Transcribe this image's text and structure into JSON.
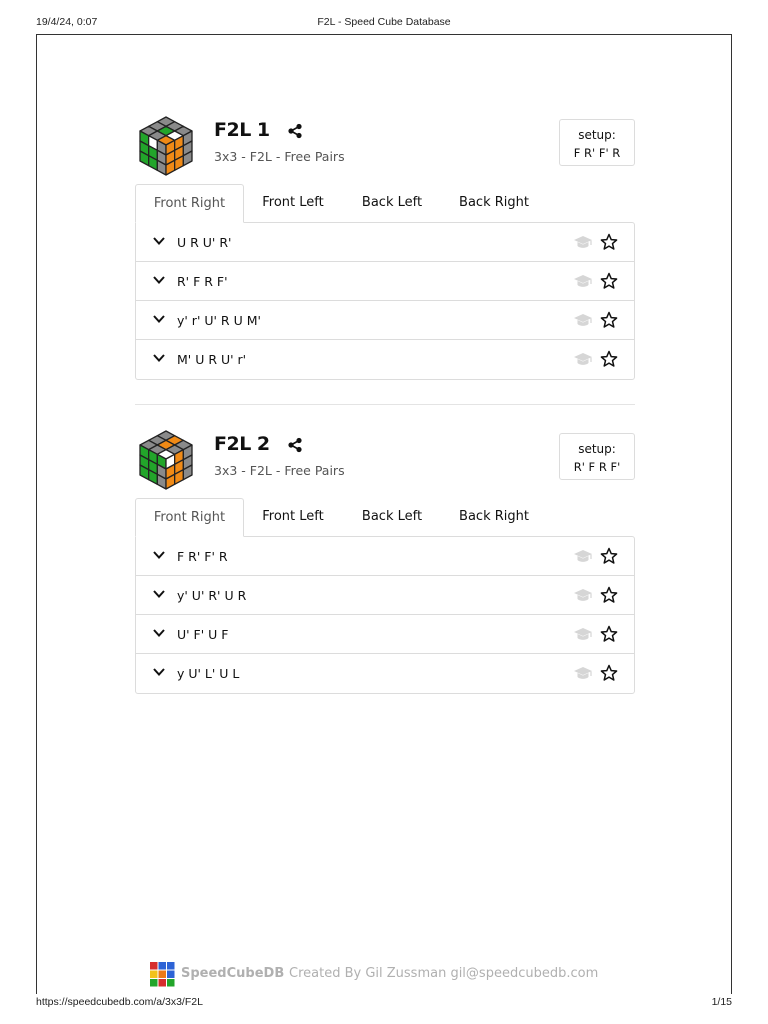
{
  "print": {
    "date": "19/4/24, 0:07",
    "title": "F2L - Speed Cube Database",
    "url": "https://speedcubedb.com/a/3x3/F2L",
    "page": "1/15"
  },
  "cases": [
    {
      "title": "F2L 1",
      "subtitle": "3x3 - F2L - Free Pairs",
      "setup_label": "setup:",
      "setup": "F R' F' R",
      "tabs": [
        "Front Right",
        "Front Left",
        "Back Left",
        "Back Right"
      ],
      "active_tab": "Front Right",
      "algorithms": [
        "U R U' R'",
        "R' F R F'",
        "y' r' U' R U M'",
        "M' U R U' r'"
      ],
      "cube_icon": {
        "name": "f2l-1-cube-icon",
        "top": [
          "gray",
          "gray",
          "gray",
          "gray",
          "green",
          "gray",
          "gray",
          "white",
          "orange"
        ],
        "front": [
          "green",
          "white",
          "gray",
          "green",
          "green",
          "gray",
          "green",
          "green",
          "gray"
        ],
        "right": [
          "orange",
          "orange",
          "gray",
          "orange",
          "orange",
          "gray",
          "orange",
          "orange",
          "gray"
        ]
      }
    },
    {
      "title": "F2L 2",
      "subtitle": "3x3 - F2L - Free Pairs",
      "setup_label": "setup:",
      "setup": "R' F R F'",
      "tabs": [
        "Front Right",
        "Front Left",
        "Back Left",
        "Back Right"
      ],
      "active_tab": "Front Right",
      "algorithms": [
        "F R' F' R",
        "y' U' R' U R",
        "U' F' U F",
        "y U' L' U L"
      ],
      "cube_icon": {
        "name": "f2l-2-cube-icon",
        "top": [
          "gray",
          "gray",
          "gray",
          "orange",
          "orange",
          "gray",
          "gray",
          "gray",
          "white"
        ],
        "front": [
          "green",
          "green",
          "green",
          "green",
          "green",
          "gray",
          "green",
          "green",
          "gray"
        ],
        "right": [
          "white",
          "orange",
          "gray",
          "orange",
          "orange",
          "gray",
          "orange",
          "orange",
          "gray"
        ]
      }
    }
  ],
  "footer": {
    "brand": "SpeedCubeDB",
    "credit": "Created By Gil Zussman  gil@speedcubedb.com"
  },
  "colors": {
    "green": "#22a52a",
    "orange": "#f08a16",
    "white": "#ffffff",
    "gray": "#8a8a8a",
    "outline": "#222222",
    "border": "#dcdcdc",
    "muted_text": "#555555",
    "footer_text": "#b0b0b0"
  }
}
